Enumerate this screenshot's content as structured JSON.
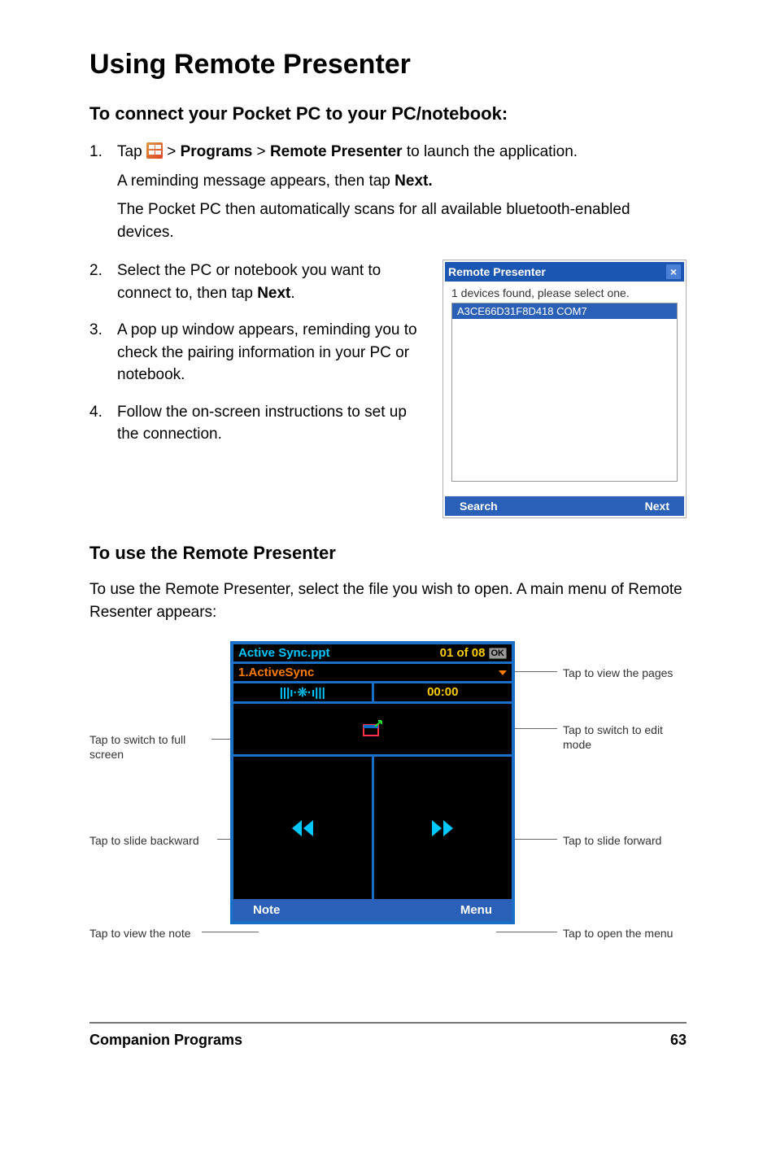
{
  "title": "Using Remote Presenter",
  "h2a": "To connect your Pocket PC to your PC/notebook:",
  "step1a": "Tap ",
  "step1b": " > ",
  "step1_prog": "Programs",
  "step1c": " > ",
  "step1_rp": "Remote Presenter",
  "step1d": " to launch the application.",
  "step1_p2a": "A reminding message appears, then tap ",
  "step1_p2_next": "Next.",
  "step1_p3": "The Pocket PC then automatically scans for all available bluetooth-enabled devices.",
  "step2a": "Select the PC or notebook you want to connect to, then tap ",
  "step2_next": "Next",
  "step2_dot": ".",
  "step3": "A pop up window appears, reminding you to check the pairing information in your PC or notebook.",
  "step4": "Follow the on-screen instructions to set up the connection.",
  "dlg_title": "Remote Presenter",
  "dlg_close": "×",
  "dlg_found": "1 devices found, please select one.",
  "dlg_item": "A3CE66D31F8D418 COM7",
  "dlg_search": "Search",
  "dlg_next": "Next",
  "h2b": "To use the Remote Presenter",
  "para2": "To use the Remote Presenter, select the file you wish to open. A main menu of Remote Resenter appears:",
  "callouts": {
    "full": "Tap to switch to full screen",
    "back": "Tap to slide backward",
    "note": "Tap to view the note",
    "pages": "Tap to view the pages",
    "edit": "Tap to switch to edit mode",
    "fwd": "Tap to slide forward",
    "menu": "Tap to open the menu"
  },
  "phone": {
    "file": "Active Sync.ppt",
    "page": "01 of 08",
    "ok": "OK",
    "slide": "1.ActiveSync",
    "bt": "|||ı·❊·ı|||",
    "time": "00:00",
    "note": "Note",
    "menu": "Menu"
  },
  "footer_left": "Companion Programs",
  "footer_right": "63"
}
